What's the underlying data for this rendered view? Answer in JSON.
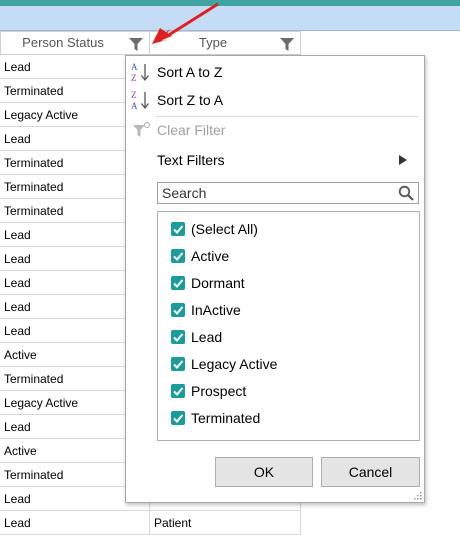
{
  "grid": {
    "columns": [
      {
        "label": "Person Status"
      },
      {
        "label": "Type"
      }
    ],
    "rows": [
      {
        "status": "Lead",
        "type": ""
      },
      {
        "status": "Terminated",
        "type": ""
      },
      {
        "status": "Legacy Active",
        "type": ""
      },
      {
        "status": "Lead",
        "type": ""
      },
      {
        "status": "Terminated",
        "type": ""
      },
      {
        "status": "Terminated",
        "type": ""
      },
      {
        "status": "Terminated",
        "type": ""
      },
      {
        "status": "Lead",
        "type": ""
      },
      {
        "status": "Lead",
        "type": ""
      },
      {
        "status": "Lead",
        "type": ""
      },
      {
        "status": "Lead",
        "type": ""
      },
      {
        "status": "Lead",
        "type": ""
      },
      {
        "status": "Active",
        "type": ""
      },
      {
        "status": "Terminated",
        "type": ""
      },
      {
        "status": "Legacy Active",
        "type": ""
      },
      {
        "status": "Lead",
        "type": ""
      },
      {
        "status": "Active",
        "type": ""
      },
      {
        "status": "Terminated",
        "type": ""
      },
      {
        "status": "Lead",
        "type": ""
      },
      {
        "status": "Lead",
        "type": "Patient"
      }
    ]
  },
  "filter_menu": {
    "sort_asc": "Sort A to Z",
    "sort_desc": "Sort Z to A",
    "clear_filter": "Clear Filter",
    "text_filters": "Text Filters",
    "search_placeholder": "Search",
    "options": [
      {
        "label": "(Select All)",
        "checked": true
      },
      {
        "label": "Active",
        "checked": true
      },
      {
        "label": "Dormant",
        "checked": true
      },
      {
        "label": "InActive",
        "checked": true
      },
      {
        "label": "Lead",
        "checked": true
      },
      {
        "label": "Legacy Active",
        "checked": true
      },
      {
        "label": "Prospect",
        "checked": true
      },
      {
        "label": "Terminated",
        "checked": true
      }
    ],
    "ok": "OK",
    "cancel": "Cancel"
  },
  "colors": {
    "header_teal": "#3fa3a0",
    "ribbon_blue": "#c5dcf7",
    "checkbox_teal": "#1a9c9c",
    "annotation_arrow": "#e02020"
  },
  "icons": {
    "column_filter": "funnel-icon",
    "sort_asc": "sort-az-icon",
    "sort_desc": "sort-za-icon",
    "clear_filter": "funnel-clear-icon",
    "submenu": "chevron-right-icon",
    "search": "magnifier-icon",
    "annotation": "red-arrow"
  }
}
